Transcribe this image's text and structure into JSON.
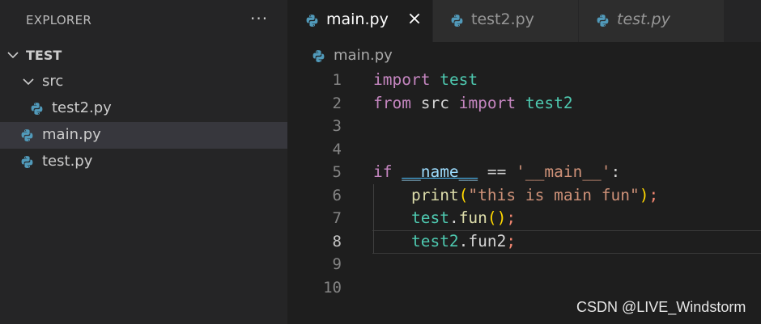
{
  "sidebar": {
    "title": "EXPLORER",
    "more_glyph": "···",
    "tree": {
      "root": "TEST",
      "folder": "src",
      "items": [
        "test2.py",
        "main.py",
        "test.py"
      ]
    }
  },
  "tabs": [
    {
      "label": "main.py",
      "state": "active"
    },
    {
      "label": "test2.py",
      "state": "inactive"
    },
    {
      "label": "test.py",
      "state": "preview"
    }
  ],
  "breadcrumb": {
    "file": "main.py"
  },
  "editor": {
    "line_numbers": [
      "1",
      "2",
      "3",
      "4",
      "5",
      "6",
      "7",
      "8",
      "9",
      "10"
    ],
    "active_line": 8,
    "code": {
      "l1": {
        "kw": "import",
        "mod": "test"
      },
      "l2": {
        "kw1": "from",
        "plain": "src",
        "kw2": "import",
        "mod": "test2"
      },
      "l5": {
        "kw": "if",
        "dunder": "__name__",
        "op": "==",
        "str": "'__main__'",
        "colon": ":"
      },
      "l6": {
        "fn": "print",
        "lp": "(",
        "str": "\"this is main fun\"",
        "rp": ")",
        "semi": ";"
      },
      "l7": {
        "mod": "test",
        "dot": ".",
        "fn": "fun",
        "parens": "()",
        "semi": ";"
      },
      "l8": {
        "mod": "test2",
        "dot": ".",
        "fn": "fun2",
        "semi": ";"
      }
    }
  },
  "watermark": "CSDN @LIVE_Windstorm",
  "colors": {
    "background": "#1e1e1e",
    "sidebar": "#252526",
    "keyword": "#c586c0",
    "module": "#4ec9b0",
    "string": "#ce9178",
    "function": "#dcdcaa",
    "python_icon": "#519aba"
  },
  "icons": [
    "python-file-icon",
    "chevron-down-icon",
    "close-icon",
    "more-icon"
  ]
}
